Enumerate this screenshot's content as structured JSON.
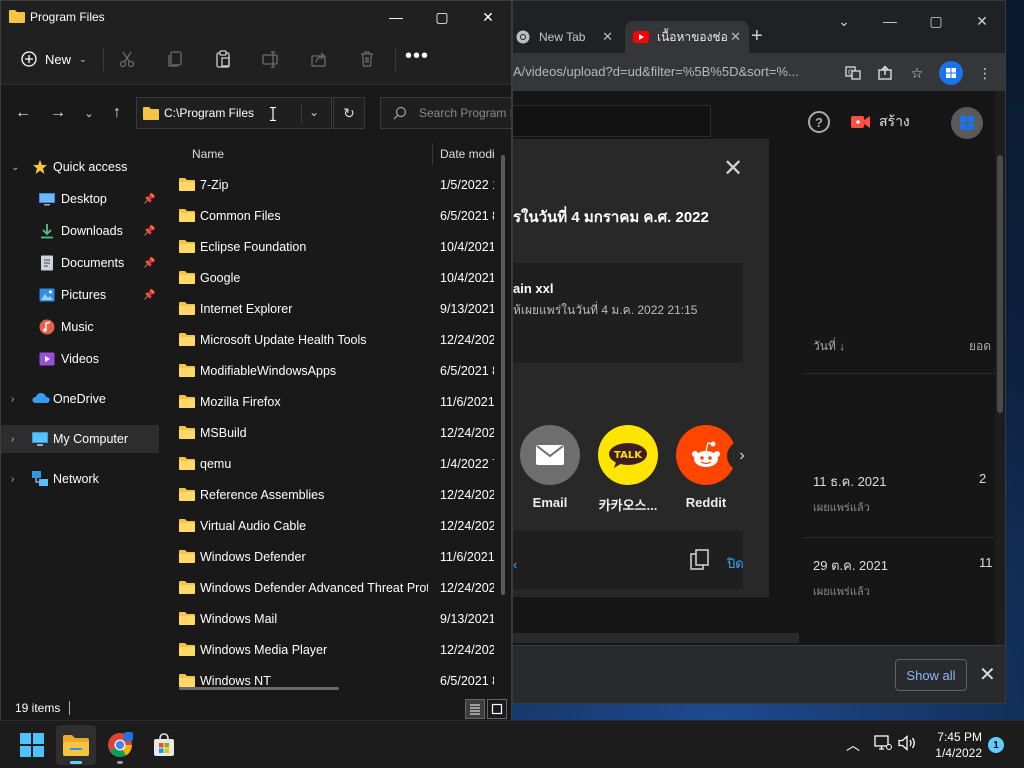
{
  "explorer": {
    "title": "Program Files",
    "toolbar": {
      "new_label": "New",
      "more_label": "•••"
    },
    "address": {
      "path": "C:\\Program Files"
    },
    "search": {
      "placeholder": "Search Program F"
    },
    "sidebar": {
      "quick_access": "Quick access",
      "items": [
        {
          "label": "Desktop",
          "icon": "desktop-icon",
          "pinned": true
        },
        {
          "label": "Downloads",
          "icon": "downloads-icon",
          "pinned": true
        },
        {
          "label": "Documents",
          "icon": "documents-icon",
          "pinned": true
        },
        {
          "label": "Pictures",
          "icon": "pictures-icon",
          "pinned": true
        },
        {
          "label": "Music",
          "icon": "music-icon",
          "pinned": false
        },
        {
          "label": "Videos",
          "icon": "videos-icon",
          "pinned": false
        }
      ],
      "onedrive": "OneDrive",
      "mycomputer": "My Computer",
      "network": "Network"
    },
    "columns": {
      "name": "Name",
      "date": "Date modi"
    },
    "files": [
      {
        "name": "7-Zip",
        "date": "1/5/2022 1"
      },
      {
        "name": "Common Files",
        "date": "6/5/2021 8"
      },
      {
        "name": "Eclipse Foundation",
        "date": "10/4/2021"
      },
      {
        "name": "Google",
        "date": "10/4/2021"
      },
      {
        "name": "Internet Explorer",
        "date": "9/13/2021"
      },
      {
        "name": "Microsoft Update Health Tools",
        "date": "12/24/2021"
      },
      {
        "name": "ModifiableWindowsApps",
        "date": "6/5/2021 8"
      },
      {
        "name": "Mozilla Firefox",
        "date": "11/6/2021"
      },
      {
        "name": "MSBuild",
        "date": "12/24/2021"
      },
      {
        "name": "qemu",
        "date": "1/4/2022 7"
      },
      {
        "name": "Reference Assemblies",
        "date": "12/24/2021"
      },
      {
        "name": "Virtual Audio Cable",
        "date": "12/24/2021"
      },
      {
        "name": "Windows Defender",
        "date": "11/6/2021"
      },
      {
        "name": "Windows Defender Advanced Threat Prot...",
        "date": "12/24/2021"
      },
      {
        "name": "Windows Mail",
        "date": "9/13/2021"
      },
      {
        "name": "Windows Media Player",
        "date": "12/24/2021"
      },
      {
        "name": "Windows NT",
        "date": "6/5/2021 8"
      }
    ],
    "status": {
      "count": "19 items"
    }
  },
  "chrome": {
    "tabs": [
      {
        "title": "New Tab",
        "icon": "chrome-icon"
      },
      {
        "title": "เนื้อหาของช่อ",
        "icon": "youtube-icon"
      }
    ],
    "url": "A/videos/upload?d=ud&filter=%5B%5D&sort=%...",
    "youtube": {
      "create_label": "สร้าง",
      "column_date": "วันที่",
      "column_views": "ยอด",
      "rows": [
        {
          "date": "11 ธ.ค. 2021",
          "status": "เผยแพร่แล้ว",
          "count": "2"
        },
        {
          "date": "29 ต.ค. 2021",
          "status": "เผยแพร่แล้ว",
          "count": "11"
        }
      ]
    },
    "share_dialog": {
      "title": "รในวันที่ 4 มกราคม ค.ศ. 2022",
      "video_title": "ain xxl",
      "video_sub": "ห้เผยแพร่ในวันที่ 4 ม.ค. 2022 21:15",
      "apps": [
        {
          "label": "Email",
          "color": "#6e6e6e"
        },
        {
          "label": "카카오스...",
          "color": "#fee500"
        },
        {
          "label": "Reddit",
          "color": "#ff4500"
        }
      ],
      "close_label": "ปิด"
    },
    "download_bar": {
      "show_all": "Show all"
    }
  },
  "taskbar": {
    "time": "7:45 PM",
    "date": "1/4/2022",
    "notifications": "1"
  },
  "colors": {
    "accent": "#60cdff",
    "folder": "#f4c542",
    "youtube_red": "#ff0000",
    "link_blue": "#3ea6ff"
  }
}
